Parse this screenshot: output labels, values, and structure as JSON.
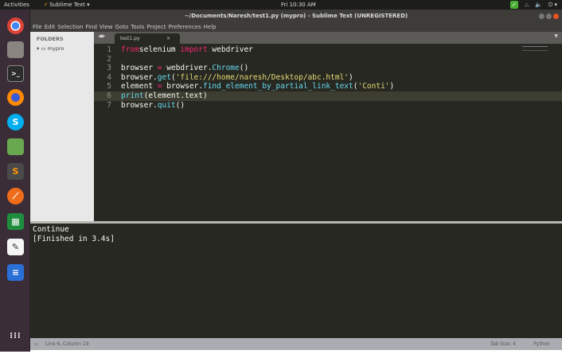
{
  "topbar": {
    "activities": "Activities",
    "app": "Sublime Text ▾",
    "clock": "Fri 10:30 AM"
  },
  "window": {
    "title": "~/Documents/Naresh/test1.py (mypro) - Sublime Text (UNREGISTERED)"
  },
  "menu": [
    "File",
    "Edit",
    "Selection",
    "Find",
    "View",
    "Goto",
    "Tools",
    "Project",
    "Preferences",
    "Help"
  ],
  "sidebar": {
    "header": "FOLDERS",
    "folder": "mypro"
  },
  "tab": {
    "name": "test1.py",
    "close": "×"
  },
  "code": [
    [
      [
        "k",
        "from"
      ],
      [
        "",
        "selenium "
      ],
      [
        "k",
        "import"
      ],
      [
        "",
        " webdriver"
      ]
    ],
    [],
    [
      [
        "",
        "browser "
      ],
      [
        "k",
        "="
      ],
      [
        "",
        " webdriver."
      ],
      [
        "f",
        "Chrome"
      ],
      [
        "",
        "()"
      ]
    ],
    [
      [
        "",
        "browser."
      ],
      [
        "f",
        "get"
      ],
      [
        "",
        "("
      ],
      [
        "s",
        "'file:///home/naresh/Desktop/abc.html'"
      ],
      [
        "",
        ")"
      ]
    ],
    [
      [
        "",
        "element "
      ],
      [
        "k",
        "="
      ],
      [
        "",
        " browser."
      ],
      [
        "f",
        "find_element_by_partial_link_text"
      ],
      [
        "",
        "("
      ],
      [
        "s",
        "'Conti'"
      ],
      [
        "",
        ")"
      ]
    ],
    [
      [
        "f",
        "print"
      ],
      [
        "",
        "(element.text)"
      ]
    ],
    [
      [
        "",
        "browser."
      ],
      [
        "f",
        "quit"
      ],
      [
        "",
        "()"
      ]
    ]
  ],
  "current_line": 6,
  "output": [
    "Continue",
    "[Finished in 3.4s]"
  ],
  "status": {
    "position": "Line 6, Column 19",
    "tab_size": "Tab Size: 4",
    "syntax": "Python"
  }
}
